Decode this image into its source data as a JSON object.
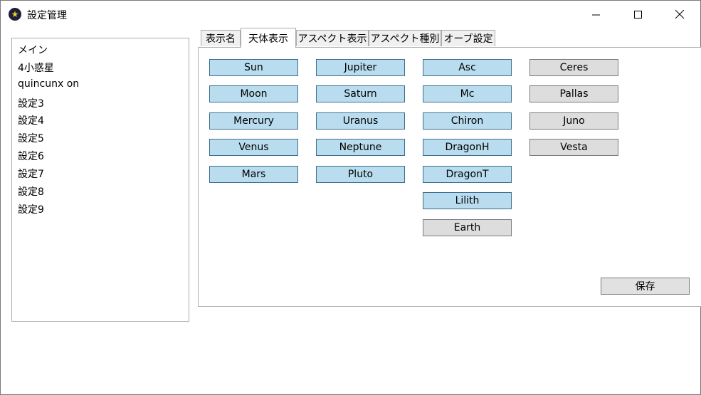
{
  "window": {
    "title": "設定管理",
    "icon": "star-in-circle-icon",
    "controls": {
      "minimize": "minimize-icon",
      "maximize": "maximize-icon",
      "close": "close-icon"
    }
  },
  "settings_list": {
    "items": [
      "メイン",
      "4小惑星",
      "quincunx on",
      "設定3",
      "設定4",
      "設定5",
      "設定6",
      "設定7",
      "設定8",
      "設定9"
    ]
  },
  "tabs": [
    {
      "label": "表示名",
      "active": false
    },
    {
      "label": "天体表示",
      "active": true
    },
    {
      "label": "アスペクト表示",
      "active": false
    },
    {
      "label": "アスペクト種別",
      "active": false
    },
    {
      "label": "オーブ設定",
      "active": false
    }
  ],
  "colors": {
    "on": "#b9dcee",
    "off": "#dddddd"
  },
  "bodies": {
    "col1": [
      {
        "label": "Sun",
        "on": true
      },
      {
        "label": "Moon",
        "on": true
      },
      {
        "label": "Mercury",
        "on": true
      },
      {
        "label": "Venus",
        "on": true
      },
      {
        "label": "Mars",
        "on": true
      }
    ],
    "col2": [
      {
        "label": "Jupiter",
        "on": true
      },
      {
        "label": "Saturn",
        "on": true
      },
      {
        "label": "Uranus",
        "on": true
      },
      {
        "label": "Neptune",
        "on": true
      },
      {
        "label": "Pluto",
        "on": true
      }
    ],
    "col3": [
      {
        "label": "Asc",
        "on": true
      },
      {
        "label": "Mc",
        "on": true
      },
      {
        "label": "Chiron",
        "on": true
      },
      {
        "label": "DragonH",
        "on": true
      },
      {
        "label": "DragonT",
        "on": true
      },
      {
        "label": "Lilith",
        "on": true
      },
      {
        "label": "Earth",
        "on": false
      }
    ],
    "col4": [
      {
        "label": "Ceres",
        "on": false
      },
      {
        "label": "Pallas",
        "on": false
      },
      {
        "label": "Juno",
        "on": false
      },
      {
        "label": "Vesta",
        "on": false
      }
    ]
  },
  "save_label": "保存"
}
